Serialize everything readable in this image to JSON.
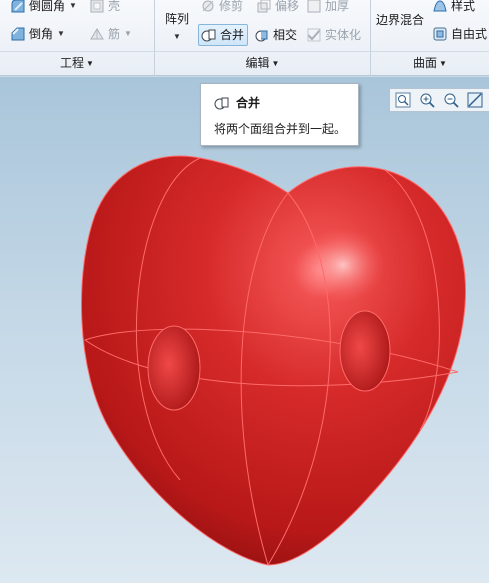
{
  "ribbon": {
    "groups": {
      "engineering": {
        "label": "工程",
        "items": [
          {
            "label": "倒圆角",
            "icon": "round-icon",
            "has_dropdown": true
          },
          {
            "label": "壳",
            "icon": "shell-icon",
            "disabled": true
          },
          {
            "label": "倒角",
            "icon": "chamfer-icon",
            "has_dropdown": true
          },
          {
            "label": "筋",
            "icon": "rib-icon",
            "disabled": true,
            "has_dropdown": true
          }
        ]
      },
      "editing": {
        "label": "编辑",
        "pattern_label": "阵列",
        "items": [
          {
            "label": "修剪",
            "icon": "trim-icon",
            "disabled": true
          },
          {
            "label": "偏移",
            "icon": "offset-icon",
            "disabled": true
          },
          {
            "label": "加厚",
            "icon": "thicken-icon",
            "disabled": true
          },
          {
            "label": "合并",
            "icon": "merge-icon",
            "active": true
          },
          {
            "label": "相交",
            "icon": "intersect-icon"
          },
          {
            "label": "实体化",
            "icon": "solidify-icon",
            "disabled": true
          }
        ]
      },
      "surfaces": {
        "label": "曲面",
        "items": [
          {
            "label": "边界混合",
            "icon": "boundary-blend-icon"
          },
          {
            "label": "样式",
            "icon": "style-icon"
          },
          {
            "label": "自由式",
            "icon": "freestyle-icon"
          }
        ]
      }
    }
  },
  "tooltip": {
    "title": "合并",
    "description": "将两个面组合并到一起。"
  },
  "view_toolbar": [
    "zoom-fit-icon",
    "zoom-in-icon",
    "zoom-out-icon",
    "repaint-icon"
  ],
  "colors": {
    "heart": "#d42424",
    "heart_edges": "#ff6a6a",
    "ribbon_bg": "#eef2f7",
    "viewport_top": "#a9c5da",
    "active_highlight": "#cfe6f9"
  }
}
